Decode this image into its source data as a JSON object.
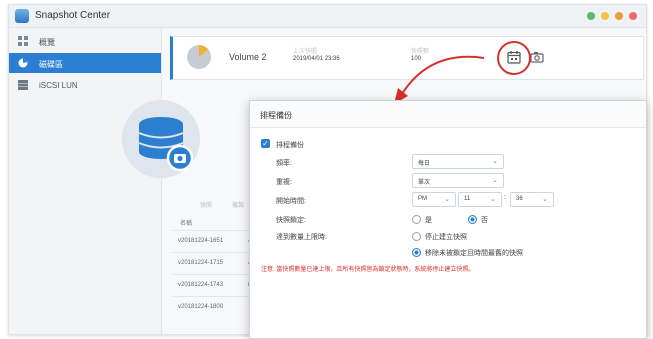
{
  "app": {
    "title": "Snapshot Center",
    "window_buttons": [
      "#5fb86f",
      "#f2c342",
      "#f09a3e",
      "#e86a6a"
    ],
    "accent": "#2c7fd0"
  },
  "sidebar": {
    "items": [
      {
        "label": "概覽",
        "icon": "overview-icon"
      },
      {
        "label": "磁碟區",
        "icon": "volume-icon",
        "active": true
      },
      {
        "label": "iSCSI LUN",
        "icon": "lun-icon"
      }
    ]
  },
  "volume_row": {
    "name": "Volume 2",
    "last_snapshot_label": "上次快照",
    "last_snapshot": "2019/04/01 23:36",
    "count_label": "快照數",
    "count": "100"
  },
  "snapshot_table": {
    "tabs": [
      "快照",
      "複製"
    ],
    "headers": [
      "名稱",
      "建"
    ],
    "rows": [
      {
        "name": "v20181224-1651",
        "col2": "AS"
      },
      {
        "name": "v20181224-1715",
        "col2": "AS"
      },
      {
        "name": "v20181224-1743",
        "col2": "ma"
      },
      {
        "name": "v20181224-1800",
        "col2": ""
      }
    ]
  },
  "dialog": {
    "title": "排程備份",
    "enable_label": "排程備份",
    "frequency_label": "頻率:",
    "frequency_value": "每日",
    "repeat_label": "重複:",
    "repeat_value": "單次",
    "start_time_label": "開始時間:",
    "ampm_value": "PM",
    "hour_value": "11",
    "minute_value": "36",
    "lock_label": "快照鎖定:",
    "lock_yes": "是",
    "lock_no": "否",
    "limit_label": "達到數量上限時:",
    "limit_option1": "停止建立快照",
    "limit_option2": "移除未被鎖定且時間最舊的快照",
    "note": "注意: 當快照數量已達上限，且所有快照皆為鎖定狀態時，系統將停止建立快照。"
  }
}
